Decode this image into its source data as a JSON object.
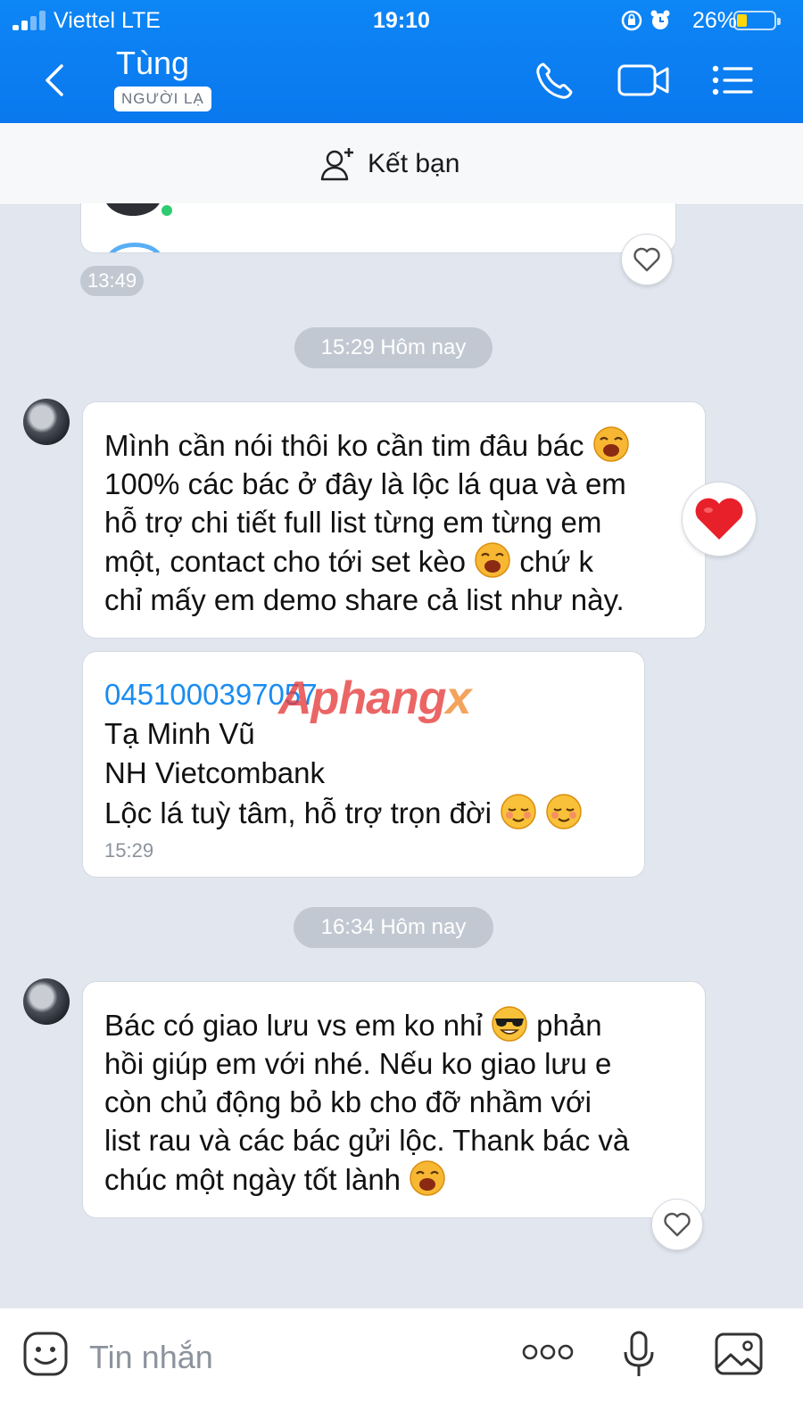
{
  "status": {
    "carrier": "Viettel  LTE",
    "time": "19:10",
    "battery": "26%"
  },
  "header": {
    "name": "Tùng",
    "badge": "NGƯỜI LẠ"
  },
  "add_friend": {
    "label": "Kết bạn"
  },
  "chat": {
    "prev_time": "13:49",
    "sep1": "15:29 Hôm nay",
    "msg1": {
      "line1": "Mình cần nói thôi ko cần tim đâu bác",
      "line2": "100% các bác ở đây là lộc lá qua và em",
      "line3": "hỗ trợ chi tiết full list từng em từng em",
      "line4a": "một, contact cho tới set kèo",
      "line4b": "chứ k",
      "line5": "chỉ mấy em demo share cả list như này."
    },
    "msg2": {
      "account": "0451000397057",
      "name": "Tạ Minh Vũ",
      "bank": "NH Vietcombank",
      "note": "Lộc lá tuỳ tâm, hỗ trợ trọn đời",
      "time": "15:29",
      "watermark": "Aphang",
      "watermark_x": "x"
    },
    "sep2": "16:34 Hôm nay",
    "msg3": {
      "line1a": "Bác có giao lưu vs em ko nhỉ",
      "line1b": "phản",
      "line2": "hồi giúp em với nhé. Nếu ko giao lưu e",
      "line3": "còn chủ động bỏ kb cho đỡ nhầm với",
      "line4": "list rau và các bác gửi lộc. Thank bác và",
      "line5": "chúc một ngày tốt lành"
    }
  },
  "input": {
    "placeholder": "Tin nhắn"
  },
  "colors": {
    "header": "#0a78ee",
    "link": "#1a8cf0",
    "heart": "#e8202a"
  }
}
